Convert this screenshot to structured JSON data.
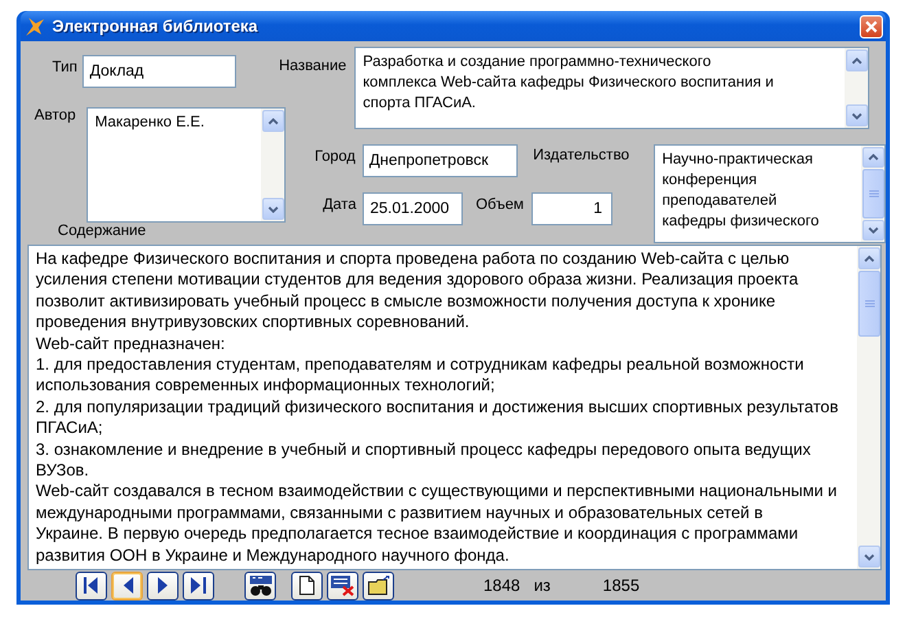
{
  "window": {
    "title": "Электронная библиотека"
  },
  "fields": {
    "type": {
      "label": "Тип",
      "value": "Доклад"
    },
    "title": {
      "label": "Название",
      "lines": [
        "Разработка и создание программно-технического",
        "комплекса Web-сайта кафедры Физического воспитания и",
        "спорта ПГАСиА."
      ]
    },
    "author": {
      "label": "Автор",
      "lines": [
        "Макаренко Е.Е."
      ]
    },
    "city": {
      "label": "Город",
      "value": "Днепропетровск"
    },
    "publisher": {
      "label": "Издательство",
      "lines": [
        "Научно-практическая",
        "конференция",
        "преподавателей",
        "кафедры физического"
      ]
    },
    "date": {
      "label": "Дата",
      "value": "25.01.2000"
    },
    "volume": {
      "label": "Объем",
      "value": "1"
    }
  },
  "content": {
    "label": "Содержание",
    "lines": [
      "На кафедре Физического воспитания и спорта проведена работа по созданию Web-сайта с целью",
      "усиления степени мотивации студентов для ведения здорового образа жизни. Реализация проекта",
      "позволит активизировать учебный процесс в смысле возможности получения доступа к хронике",
      "проведения внутривузовских спортивных соревнований.",
      "Web-сайт предназначен:",
      "1. для предоставления студентам, преподавателям и сотрудникам кафедры реальной возможности",
      "использования современных информационных технологий;",
      "2. для популяризации традиций физического воспитания и достижения высших спортивных результатов",
      "ПГАСиА;",
      "3. ознакомление и внедрение в учебный и спортивный процесс кафедры передового опыта ведущих",
      "ВУЗов.",
      "Web-сайт создавался в тесном взаимодействии с существующими и перспективными национальными и",
      "международными программами, связанными с развитием научных и образовательных сетей в",
      "Украине. В первую очередь предполагается тесное взаимодействие и координация с программами",
      "развития ООН в Украине и Международного научного фонда."
    ]
  },
  "nav_buttons": [
    {
      "kind": "first",
      "focused": false
    },
    {
      "kind": "prev",
      "focused": true
    },
    {
      "kind": "next",
      "focused": false
    },
    {
      "kind": "last",
      "focused": false
    }
  ],
  "tool_groups": [
    [
      {
        "kind": "find"
      }
    ],
    [
      {
        "kind": "new"
      },
      {
        "kind": "delete"
      },
      {
        "kind": "open"
      }
    ]
  ],
  "record": {
    "current": "1848",
    "separator": "из",
    "total": "1855"
  }
}
